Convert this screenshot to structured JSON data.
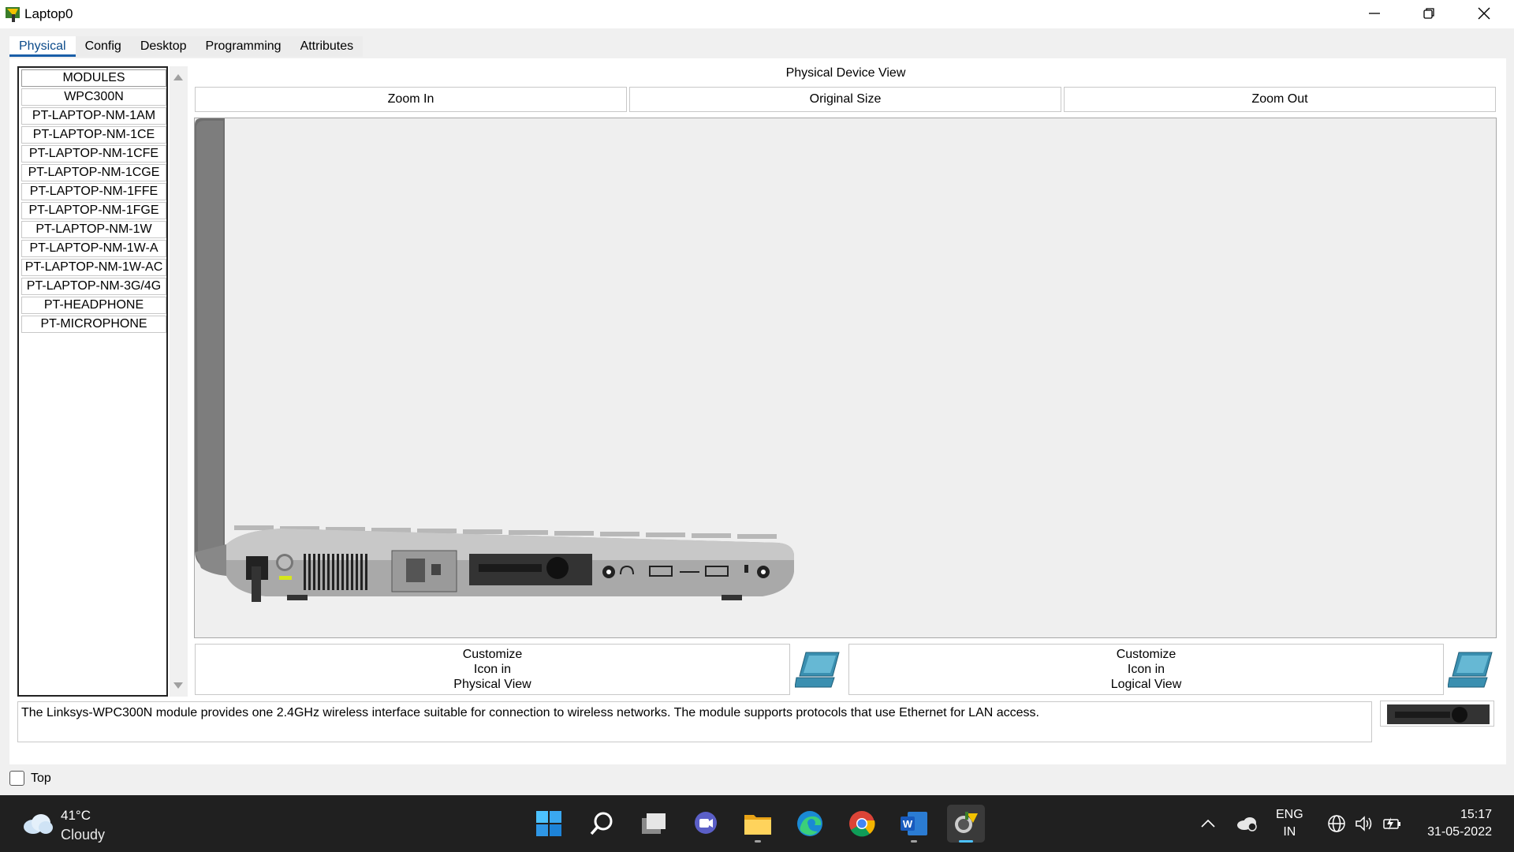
{
  "window": {
    "title": "Laptop0"
  },
  "tabs": [
    "Physical",
    "Config",
    "Desktop",
    "Programming",
    "Attributes"
  ],
  "modules": {
    "header": "MODULES",
    "items": [
      "WPC300N",
      "PT-LAPTOP-NM-1AM",
      "PT-LAPTOP-NM-1CE",
      "PT-LAPTOP-NM-1CFE",
      "PT-LAPTOP-NM-1CGE",
      "PT-LAPTOP-NM-1FFE",
      "PT-LAPTOP-NM-1FGE",
      "PT-LAPTOP-NM-1W",
      "PT-LAPTOP-NM-1W-A",
      "PT-LAPTOP-NM-1W-AC",
      "PT-LAPTOP-NM-3G/4G",
      "PT-HEADPHONE",
      "PT-MICROPHONE"
    ]
  },
  "device_view": {
    "title": "Physical Device View",
    "zoom_in": "Zoom In",
    "original_size": "Original Size",
    "zoom_out": "Zoom Out"
  },
  "customize": {
    "physical": [
      "Customize",
      "Icon in",
      "Physical View"
    ],
    "logical": [
      "Customize",
      "Icon in",
      "Logical View"
    ]
  },
  "description": "The Linksys-WPC300N module provides one 2.4GHz wireless interface suitable for connection to wireless networks. The module supports protocols that use Ethernet for LAN access.",
  "top_checkbox": {
    "label": "Top",
    "checked": false
  },
  "taskbar": {
    "weather_temp": "41°C",
    "weather_desc": "Cloudy",
    "apps": [
      "start-icon",
      "search-icon",
      "task-view-icon",
      "chat-icon",
      "file-explorer-icon",
      "edge-icon",
      "chrome-icon",
      "word-icon",
      "packet-tracer-icon"
    ],
    "lang_top": "ENG",
    "lang_bottom": "IN",
    "time": "15:17",
    "date": "31-05-2022"
  },
  "colors": {
    "active_tab": "#1a5ea8",
    "taskbar_bg": "#202020",
    "taskbar_active_indicator": "#4cc2ff"
  }
}
